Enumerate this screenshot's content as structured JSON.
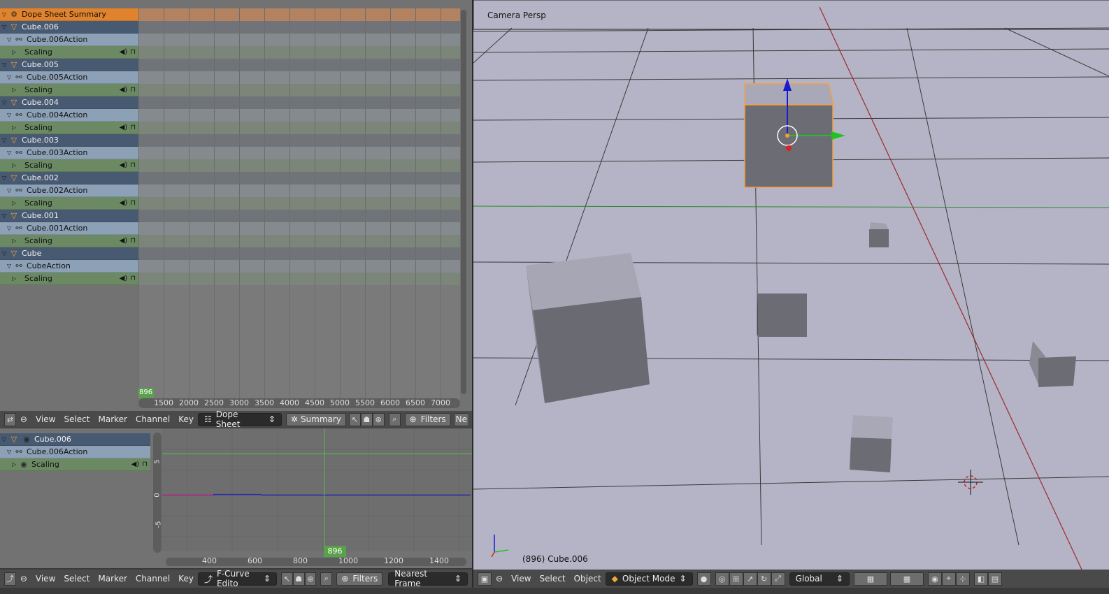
{
  "dopesheet": {
    "channels": [
      {
        "kind": "sum",
        "label": "Dope Sheet Summary",
        "icon": "dopesheet-icon"
      },
      {
        "kind": "obj",
        "label": "Cube.006",
        "icon": "object-icon"
      },
      {
        "kind": "act",
        "label": "Cube.006Action",
        "icon": "action-icon"
      },
      {
        "kind": "fc",
        "label": "Scaling"
      },
      {
        "kind": "obj",
        "label": "Cube.005",
        "icon": "object-icon"
      },
      {
        "kind": "act",
        "label": "Cube.005Action",
        "icon": "action-icon"
      },
      {
        "kind": "fc",
        "label": "Scaling"
      },
      {
        "kind": "obj",
        "label": "Cube.004",
        "icon": "object-icon"
      },
      {
        "kind": "act",
        "label": "Cube.004Action",
        "icon": "action-icon"
      },
      {
        "kind": "fc",
        "label": "Scaling"
      },
      {
        "kind": "obj",
        "label": "Cube.003",
        "icon": "object-icon"
      },
      {
        "kind": "act",
        "label": "Cube.003Action",
        "icon": "action-icon"
      },
      {
        "kind": "fc",
        "label": "Scaling"
      },
      {
        "kind": "obj",
        "label": "Cube.002",
        "icon": "object-icon"
      },
      {
        "kind": "act",
        "label": "Cube.002Action",
        "icon": "action-icon"
      },
      {
        "kind": "fc",
        "label": "Scaling"
      },
      {
        "kind": "obj",
        "label": "Cube.001",
        "icon": "object-icon"
      },
      {
        "kind": "act",
        "label": "Cube.001Action",
        "icon": "action-icon"
      },
      {
        "kind": "fc",
        "label": "Scaling"
      },
      {
        "kind": "obj",
        "label": "Cube",
        "icon": "object-icon"
      },
      {
        "kind": "act",
        "label": "CubeAction",
        "icon": "action-icon"
      },
      {
        "kind": "fc",
        "label": "Scaling"
      }
    ],
    "current_frame": "896",
    "ruler_ticks": [
      "1500",
      "2000",
      "2500",
      "3000",
      "3500",
      "4000",
      "4500",
      "5000",
      "5500",
      "6000",
      "6500",
      "7000"
    ],
    "header": {
      "view": "View",
      "select": "Select",
      "marker": "Marker",
      "channel": "Channel",
      "key": "Key",
      "mode": "Dope Sheet",
      "summary": "Summary",
      "filters": "Filters",
      "extra": "Ne"
    }
  },
  "graph": {
    "channels": [
      {
        "kind": "obj",
        "label": "Cube.006"
      },
      {
        "kind": "act",
        "label": "Cube.006Action"
      },
      {
        "kind": "fc",
        "label": "Scaling"
      }
    ],
    "y_ticks": [
      "5",
      "0",
      "-5"
    ],
    "current_frame": "896",
    "ruler_ticks": [
      "400",
      "600",
      "800",
      "1000",
      "1200",
      "1400"
    ],
    "header": {
      "view": "View",
      "select": "Select",
      "marker": "Marker",
      "channel": "Channel",
      "key": "Key",
      "mode": "F-Curve Edito",
      "filters": "Filters",
      "snap": "Nearest Frame"
    }
  },
  "viewport": {
    "title": "Camera Persp",
    "status": "(896) Cube.006",
    "header": {
      "view": "View",
      "select": "Select",
      "object": "Object",
      "mode": "Object Mode",
      "orientation": "Global"
    }
  },
  "colors": {
    "selection": "#e0832c",
    "object_row": "#485a72",
    "action_row": "#8ca0b6",
    "fcurve_row": "#6b8a63",
    "frame_marker": "#57c64a",
    "viewport_bg": "#b4b4c6"
  }
}
